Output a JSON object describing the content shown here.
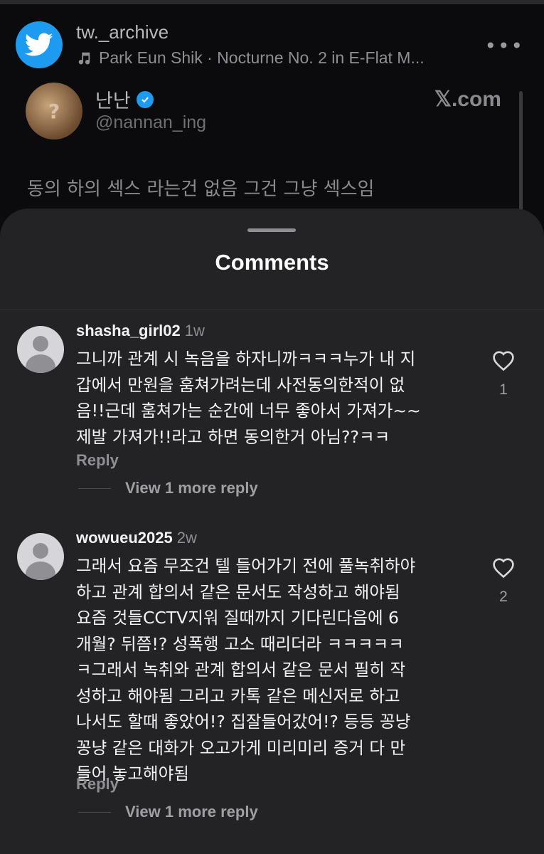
{
  "background_post": {
    "account_name": "tw._archive",
    "music_track": "Park Eun Shik · Nocturne No. 2 in E-Flat M...",
    "more_label": "•••",
    "tweet": {
      "author_name": "난난",
      "author_handle": "@nannan_ing",
      "source_label": "𝕏.com",
      "text_line1": "동의 하의 섹스 라는건 없음 그건 그냥 섹스임"
    },
    "colors": {
      "twitter_blue": "#1d9bf0"
    }
  },
  "sheet": {
    "title": "Comments",
    "comments": [
      {
        "username": "shasha_girl02",
        "age": "1w",
        "text": "그니까 관계 시 녹음을 하자니까ㅋㅋㅋ누가 내 지\n갑에서 만원을 훔쳐가려는데 사전동의한적이 없\n음!!근데 훔쳐가는 순간에 너무 좋아서 가져가~~\n제발 가져가!!라고 하면 동의한거 아님??ㅋㅋ",
        "reply_label": "Reply",
        "view_more_label": "View 1 more reply",
        "likes": "1"
      },
      {
        "username": "wowueu2025",
        "age": "2w",
        "text": "그래서 요즘 무조건 텔 들어가기 전에 풀녹취하야\n하고 관계 합의서 같은 문서도 작성하고 해야됨\n요즘 것들CCTV지워 질때까지 기다린다음에 6\n개월? 뒤쯤!? 성폭행 고소 때리더라 ㅋㅋㅋㅋㅋ\nㅋ그래서 녹취와 관계 합의서 같은 문서 필히 작\n성하고 해야됨 그리고 카톡 같은 메신저로 하고\n나서도 할때 좋았어!? 집잘들어갔어!? 등등 꽁냥\n꽁냥 같은 대화가 오고가게 미리미리 증거 다 만\n들어 놓고해야됨",
        "reply_label": "Reply",
        "view_more_label": "View 1 more reply",
        "likes": "2"
      }
    ]
  }
}
